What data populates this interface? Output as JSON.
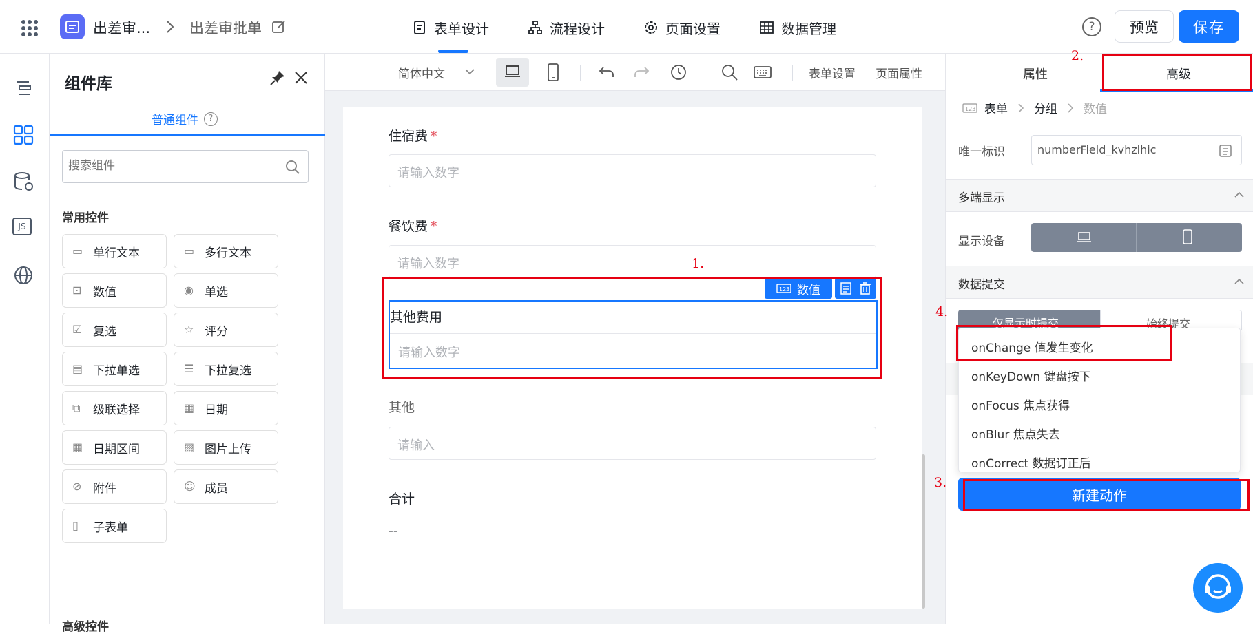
{
  "header": {
    "app_title": "出差审...",
    "breadcrumb_current": "出差审批单",
    "tabs": [
      {
        "label": "表单设计",
        "active": true
      },
      {
        "label": "流程设计",
        "active": false
      },
      {
        "label": "页面设置",
        "active": false
      },
      {
        "label": "数据管理",
        "active": false
      }
    ],
    "help_glyph": "?",
    "preview_label": "预览",
    "save_label": "保存",
    "accent_color": "#1677ff"
  },
  "rail": {
    "icons": [
      "outline-icon",
      "components-icon",
      "datasource-icon",
      "js-icon",
      "globe-icon"
    ],
    "js_label": "JS"
  },
  "library": {
    "title": "组件库",
    "tab_label": "普通组件",
    "search_placeholder": "搜索组件",
    "section_common": "常用控件",
    "section_advanced": "高级控件",
    "components": [
      {
        "label": "单行文本",
        "icon": "single-line-icon"
      },
      {
        "label": "多行文本",
        "icon": "multi-line-icon"
      },
      {
        "label": "数值",
        "icon": "number-icon"
      },
      {
        "label": "单选",
        "icon": "radio-icon"
      },
      {
        "label": "复选",
        "icon": "checkbox-icon"
      },
      {
        "label": "评分",
        "icon": "star-icon"
      },
      {
        "label": "下拉单选",
        "icon": "select-icon"
      },
      {
        "label": "下拉复选",
        "icon": "multi-select-icon"
      },
      {
        "label": "级联选择",
        "icon": "cascade-icon"
      },
      {
        "label": "日期",
        "icon": "calendar-icon"
      },
      {
        "label": "日期区间",
        "icon": "date-range-icon"
      },
      {
        "label": "图片上传",
        "icon": "image-upload-icon"
      },
      {
        "label": "附件",
        "icon": "attachment-icon"
      },
      {
        "label": "成员",
        "icon": "member-icon"
      },
      {
        "label": "子表单",
        "icon": "subform-icon"
      }
    ]
  },
  "toolbar": {
    "language": "简体中文",
    "form_settings": "表单设置",
    "page_props": "页面属性"
  },
  "form": {
    "fields": [
      {
        "label": "住宿费",
        "required": true,
        "placeholder": "请输入数字"
      },
      {
        "label": "餐饮费",
        "required": true,
        "placeholder": "请输入数字"
      },
      {
        "label": "其他费用",
        "required": false,
        "placeholder": "请输入数字",
        "selected": true
      },
      {
        "label": "其他",
        "required": false,
        "placeholder": "请输入"
      }
    ],
    "selected_tag": "数值",
    "total_label": "合计",
    "total_value": "--"
  },
  "props": {
    "tab_attr": "属性",
    "tab_advanced": "高级",
    "breadcrumb": [
      "表单",
      "分组",
      "数值"
    ],
    "unique_id_label": "唯一标识",
    "unique_id_value": "numberField_kvhzlhic",
    "section_multi": "多端显示",
    "display_device_label": "显示设备",
    "section_submit": "数据提交",
    "submit_opt1": "仅显示时提交",
    "submit_opt2": "始终提交",
    "events": [
      "onChange 值发生变化",
      "onKeyDown 键盘按下",
      "onFocus 焦点获得",
      "onBlur 焦点失去",
      "onCorrect 数据订正后"
    ],
    "new_action": "新建动作"
  },
  "annotations": [
    "1.",
    "2.",
    "3.",
    "4."
  ]
}
